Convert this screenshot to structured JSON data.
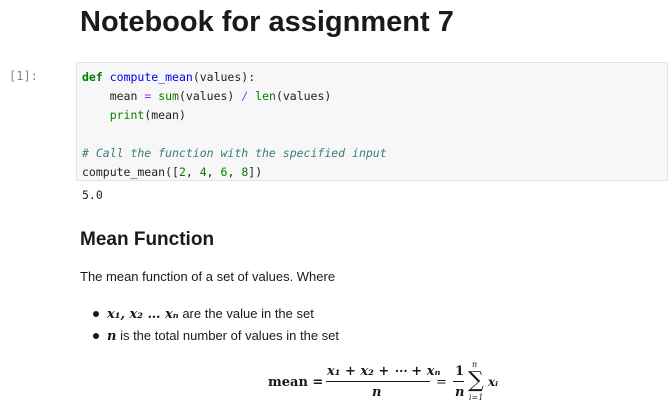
{
  "notebook": {
    "title": "Notebook for assignment 7"
  },
  "code_cell": {
    "prompt": "[1]:",
    "lines": [
      "def compute_mean(values):",
      "    mean = sum(values) / len(values)",
      "    print(mean)",
      "",
      "# Call the function with the specified input",
      "compute_mean([2, 4, 6, 8])"
    ],
    "output": "5.0"
  },
  "markdown": {
    "heading": "Mean Function",
    "paragraph": "The mean function of a set of values. Where",
    "bullets": [
      {
        "math": "x₁, x₂ … xₙ",
        "text": " are the value in the set"
      },
      {
        "math": "n",
        "text": " is the total number of values in the set"
      }
    ],
    "equation": {
      "lhs": "mean =",
      "numerator": "x₁ + x₂ + ⋯ + xₙ",
      "denominator": "n",
      "equals": "=",
      "one": "1",
      "n": "n",
      "sigma": "∑",
      "sup": "n",
      "sub": "i=1",
      "term": "xᵢ"
    }
  }
}
